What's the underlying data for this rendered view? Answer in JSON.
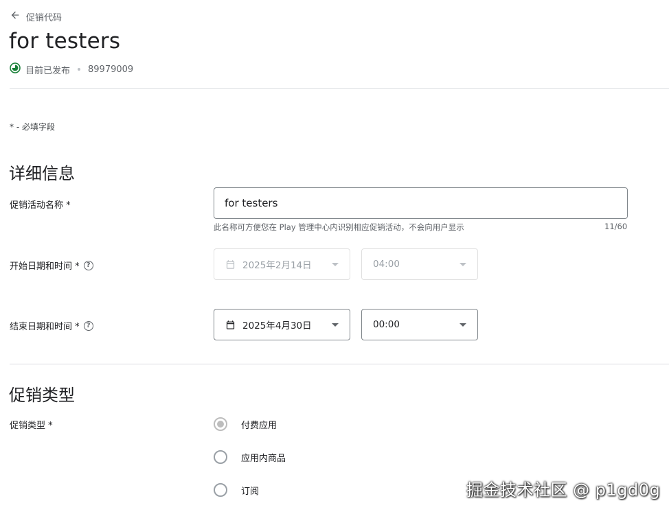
{
  "header": {
    "back_label": "促销代码",
    "title": "for testers",
    "status": "目前已发布",
    "promo_id": "89979009"
  },
  "required_note": "* - 必填字段",
  "details": {
    "section_title": "详细信息",
    "name_label": "促销活动名称 *",
    "name_value": "for testers",
    "name_helper": "此名称可方便您在 Play 管理中心内识别相应促销活动，不会向用户显示",
    "name_counter": "11/60",
    "start_label": "开始日期和时间 *",
    "start_date": "2025年2月14日",
    "start_time": "04:00",
    "end_label": "结束日期和时间 *",
    "end_date": "2025年4月30日",
    "end_time": "00:00"
  },
  "promo_type": {
    "section_title": "促销类型",
    "label": "促销类型 *",
    "options": [
      "付费应用",
      "应用内商品",
      "订阅"
    ],
    "selected": "付费应用"
  },
  "watermark": "掘金技术社区 @ p1gd0g",
  "colors": {
    "published_green": "#188038",
    "border": "#80868b",
    "divider": "#dadce0"
  }
}
